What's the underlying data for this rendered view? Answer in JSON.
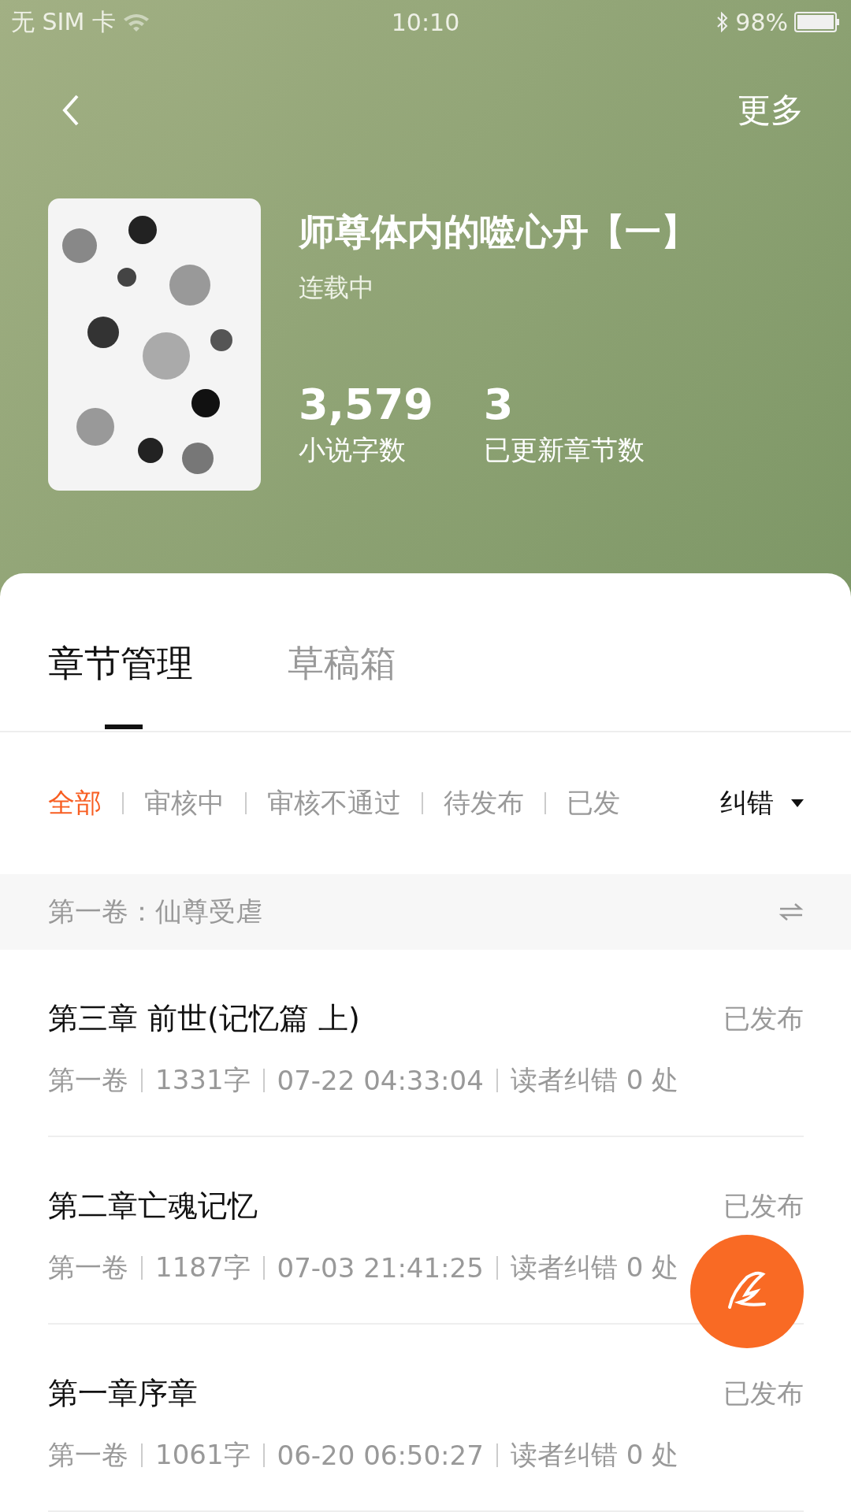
{
  "status_bar": {
    "carrier": "无 SIM 卡",
    "time": "10:10",
    "battery": "98%"
  },
  "nav": {
    "more": "更多"
  },
  "book": {
    "title": "师尊体内的噬心丹【一】",
    "status": "连载中",
    "stats": [
      {
        "value": "3,579",
        "label": "小说字数"
      },
      {
        "value": "3",
        "label": "已更新章节数"
      }
    ]
  },
  "tabs": [
    {
      "label": "章节管理",
      "selected": true
    },
    {
      "label": "草稿箱",
      "selected": false
    }
  ],
  "filters": [
    {
      "label": "全部",
      "selected": true
    },
    {
      "label": "审核中",
      "selected": false
    },
    {
      "label": "审核不通过",
      "selected": false
    },
    {
      "label": "待发布",
      "selected": false
    },
    {
      "label": "已发",
      "selected": false
    }
  ],
  "filter_dropdown": "纠错",
  "volume": "第一卷：仙尊受虐",
  "chapters": [
    {
      "title": "第三章 前世(记忆篇 上)",
      "status": "已发布",
      "volume": "第一卷",
      "words": "1331字",
      "time": "07-22 04:33:04",
      "errata": "读者纠错 0 处"
    },
    {
      "title": "第二章亡魂记忆",
      "status": "已发布",
      "volume": "第一卷",
      "words": "1187字",
      "time": "07-03 21:41:25",
      "errata": "读者纠错 0 处"
    },
    {
      "title": "第一章序章",
      "status": "已发布",
      "volume": "第一卷",
      "words": "1061字",
      "time": "06-20 06:50:27",
      "errata": "读者纠错 0 处"
    }
  ]
}
